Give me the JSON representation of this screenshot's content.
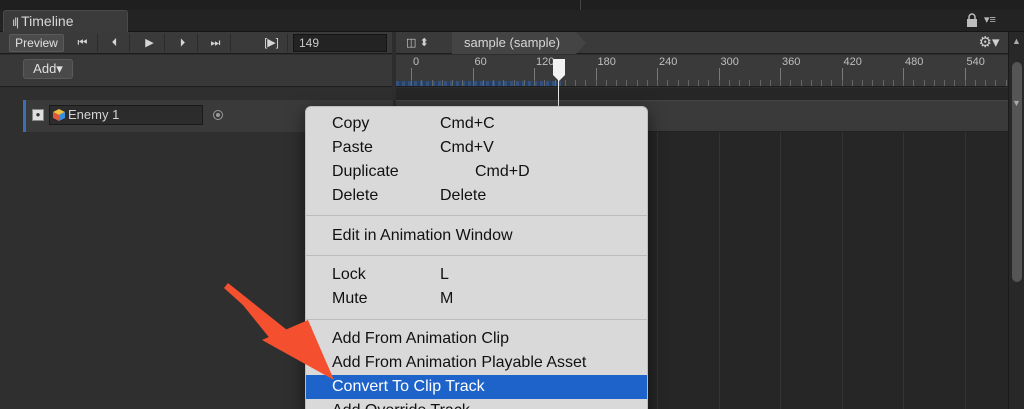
{
  "window": {
    "tab_title": "Timeline",
    "tab_icon": "timeline-icon"
  },
  "toolbar": {
    "preview_label": "Preview",
    "transport": [
      {
        "name": "goto-start-icon",
        "glyph": "⏮"
      },
      {
        "name": "prev-frame-icon",
        "glyph": "⏴"
      },
      {
        "name": "play-icon",
        "glyph": "▶"
      },
      {
        "name": "next-frame-icon",
        "glyph": "⏵"
      },
      {
        "name": "goto-end-icon",
        "glyph": "⏭"
      }
    ],
    "range_toggle": "[▶]",
    "frame_value": "149"
  },
  "breadcrumb": "sample (sample)",
  "view_toggle": "◫ ⬍",
  "add_button": "Add▾",
  "ruler": {
    "labels": [
      "0",
      "60",
      "120",
      "180",
      "240",
      "300",
      "360",
      "420",
      "480",
      "540"
    ],
    "current_frame": 149
  },
  "track": {
    "name": "Enemy 1"
  },
  "context_menu": {
    "items": [
      {
        "label": "Copy",
        "shortcut": "Cmd+C"
      },
      {
        "label": "Paste",
        "shortcut": "Cmd+V"
      },
      {
        "label": "Duplicate",
        "shortcut": "Cmd+D"
      },
      {
        "label": "Delete",
        "shortcut": "Delete"
      },
      {
        "label": "Edit in Animation Window",
        "shortcut": ""
      },
      {
        "label": "Lock",
        "shortcut": "L"
      },
      {
        "label": "Mute",
        "shortcut": "M"
      },
      {
        "label": "Add From Animation Clip",
        "shortcut": ""
      },
      {
        "label": "Add From Animation Playable Asset",
        "shortcut": ""
      },
      {
        "label": "Convert To Clip Track",
        "shortcut": ""
      },
      {
        "label": "Add Override Track",
        "shortcut": ""
      }
    ],
    "highlighted": "Convert To Clip Track"
  },
  "colors": {
    "highlight": "#1d63c9",
    "annotation_arrow": "#f4502f",
    "track_accent": "#3b6fb4"
  }
}
